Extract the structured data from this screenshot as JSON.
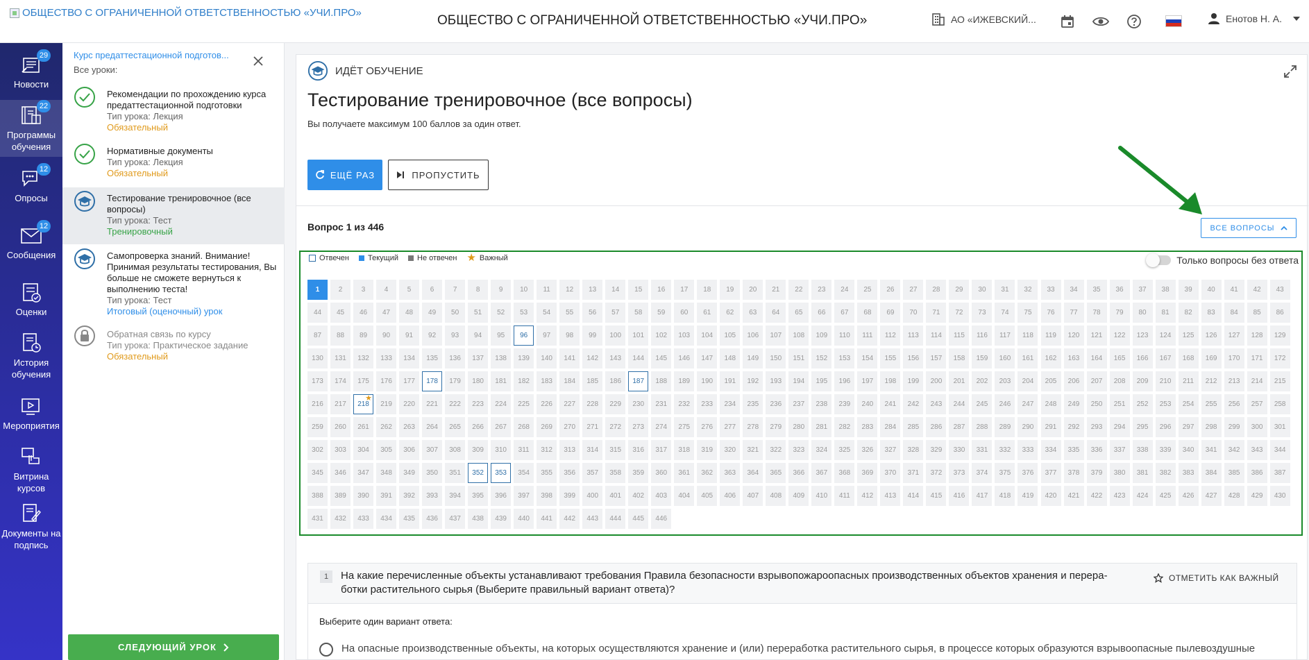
{
  "header": {
    "logo_text": "ОБЩЕСТВО С ОГРАНИЧЕННОЙ ОТВЕТСТВЕННОСТЬЮ «УЧИ.ПРО»",
    "org_title": "ОБЩЕСТВО С ОГРАНИЧЕННОЙ ОТВЕТСТВЕННОСТЬЮ «УЧИ.ПРО»",
    "org_selector": "АО «ИЖЕВСКИЙ...",
    "user_name": "Енотов Н. А."
  },
  "leftnav": {
    "items": [
      {
        "label": "Новости",
        "badge": "29",
        "icon": "news-icon"
      },
      {
        "label": "Программы обучения",
        "badge": "22",
        "icon": "books-icon"
      },
      {
        "label": "Опросы",
        "badge": "12",
        "icon": "chat-icon"
      },
      {
        "label": "Сообщения",
        "badge": "12",
        "icon": "envelope-icon"
      },
      {
        "label": "Оценки",
        "badge": "",
        "icon": "grades-icon"
      },
      {
        "label": "История обучения",
        "badge": "",
        "icon": "history-icon"
      },
      {
        "label": "Мероприятия",
        "badge": "",
        "icon": "events-icon"
      },
      {
        "label": "Витрина курсов",
        "badge": "",
        "icon": "showcase-icon"
      },
      {
        "label": "Документы на подпись",
        "badge": "",
        "icon": "sign-icon"
      }
    ]
  },
  "lessons": {
    "course_title": "Курс предаттестационной подготов...",
    "all_lessons_label": "Все уроки:",
    "items": [
      {
        "title": "Рекомендации по прохождению курса предаттестационной подготовки",
        "type": "Тип урока: Лекция",
        "status": "Обязательный"
      },
      {
        "title": "Нормативные документы",
        "type": "Тип урока: Лекция",
        "status": "Обязательный"
      },
      {
        "title": "Тестирование тренировочное (все вопросы)",
        "type": "Тип урока: Тест",
        "status": "Тренировочный"
      },
      {
        "title": "Самопроверка знаний. Внимание! Принимая результаты тестирования, Вы больше не сможете вернуться к выполнению теста!",
        "type": "Тип урока: Тест",
        "status": "Итоговый (оценочный) урок"
      },
      {
        "title": "Обратная связь по курсу",
        "type": "Тип урока: Практическое задание",
        "status": "Обязательный"
      }
    ],
    "next_button": "СЛЕДУЮЩИЙ УРОК"
  },
  "main": {
    "status_label": "ИДЁТ ОБУЧЕНИЕ",
    "title": "Тестирование тренировочное (все вопросы)",
    "subtitle": "Вы получаете максимум 100 баллов за один ответ.",
    "again_button": "ЕЩЁ РАЗ",
    "skip_button": "ПРОПУСТИТЬ",
    "question_counter": "Вопрос 1 из 446",
    "all_questions_button": "ВСЕ ВОПРОСЫ",
    "legend": {
      "answered": "Отвечен",
      "current": "Текущий",
      "unanswered": "Не отвечен",
      "important": "Важный"
    },
    "only_unanswered_label": "Только вопросы без ответа",
    "question_total": 446,
    "current_question": 1,
    "answered_questions": [
      96,
      178,
      187,
      218,
      352,
      353
    ],
    "important_questions": [
      218
    ],
    "question": {
      "number": "1",
      "text": "На какие перечисленные объекты устанавливают требования Правила безопасности взрывопожароопасных производственных объектов хранения и перера-ботки растительного сырья (Выберите правильный вариант ответа)?",
      "mark_important": "ОТМЕТИТЬ КАК ВАЖНЫЙ",
      "choose_label": "Выберите один вариант ответа:",
      "option_1": "На опасные производственные объекты, на которых осуществляются хранение и (или) переработка растительного сырья, в процессе которых образуются взрывоопасные пылевоздушные"
    }
  },
  "colors": {
    "accent": "#2f8ee8",
    "success": "#48ad4e",
    "warning": "#e09a1b",
    "annotation": "#1a8a2a"
  }
}
